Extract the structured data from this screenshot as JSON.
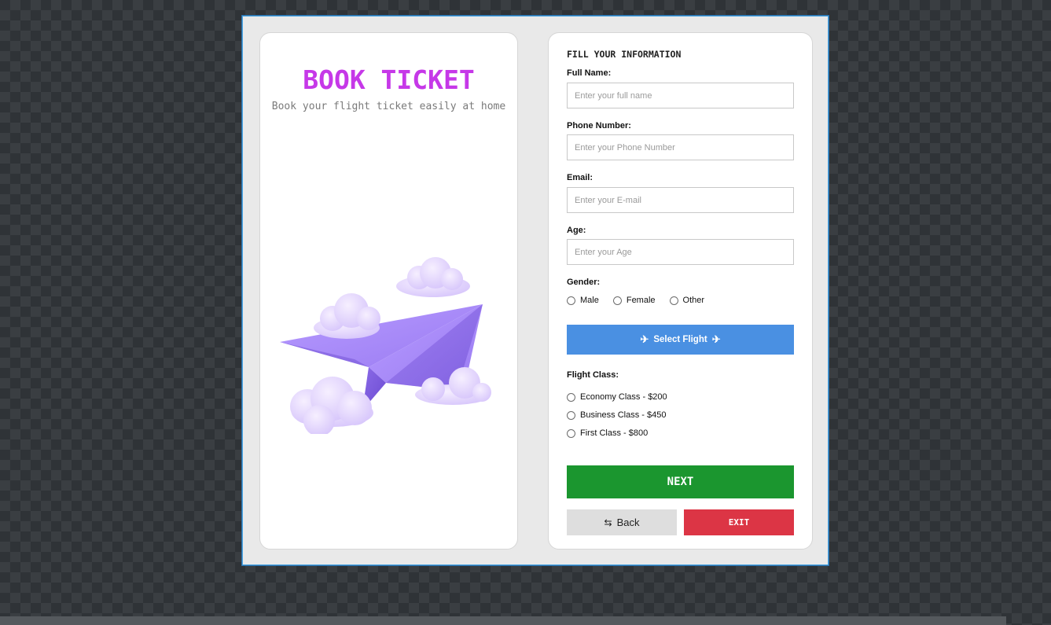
{
  "left_panel": {
    "title": "BOOK TICKET",
    "subtitle": "Book your flight ticket easily at home"
  },
  "form": {
    "heading": "FILL YOUR INFORMATION",
    "full_name": {
      "label": "Full Name:",
      "placeholder": "Enter your full name",
      "value": ""
    },
    "phone": {
      "label": "Phone Number:",
      "placeholder": "Enter your Phone Number",
      "value": ""
    },
    "email": {
      "label": "Email:",
      "placeholder": "Enter your E-mail",
      "value": ""
    },
    "age": {
      "label": "Age:",
      "placeholder": "Enter your Age",
      "value": ""
    },
    "gender": {
      "label": "Gender:",
      "options": [
        "Male",
        "Female",
        "Other"
      ],
      "selected": null
    },
    "select_flight_label": "Select Flight",
    "select_flight_icon": "airplane-icon",
    "flight_class": {
      "label": "Flight Class:",
      "options": [
        "Economy Class - $200",
        "Business Class - $450",
        "First Class - $800"
      ],
      "selected": null
    },
    "next_label": "NEXT",
    "back_label": "Back",
    "back_icon_text": "BACK",
    "exit_label": "EXIT"
  },
  "colors": {
    "title": "#c638e8",
    "select_flight": "#4a90e2",
    "next": "#1b962f",
    "exit": "#dc3545",
    "back": "#dedede"
  }
}
